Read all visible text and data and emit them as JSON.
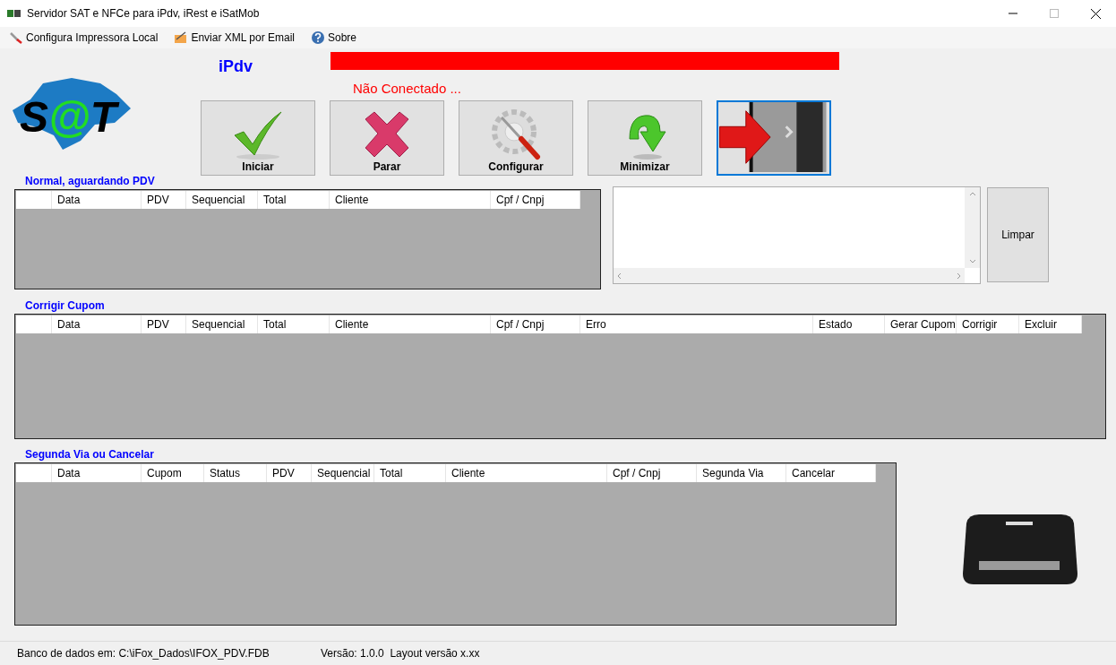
{
  "window": {
    "title": "Servidor SAT e NFCe para iPdv, iRest e iSatMob"
  },
  "menu": [
    {
      "label": "Configura Impressora Local",
      "kind": "printer"
    },
    {
      "label": "Enviar XML por Email",
      "kind": "mail"
    },
    {
      "label": "Sobre",
      "kind": "help"
    }
  ],
  "logo": {
    "parts": [
      "S",
      "@",
      "T"
    ]
  },
  "header": {
    "module": "iPdv",
    "connected": false,
    "status": "Não Conectado ..."
  },
  "buttons": [
    {
      "label": "Iniciar",
      "kind": "start",
      "focused": false
    },
    {
      "label": "Parar",
      "kind": "stop",
      "focused": false
    },
    {
      "label": "Configurar",
      "kind": "config",
      "focused": false
    },
    {
      "label": "Minimizar",
      "kind": "minimize",
      "focused": false
    },
    {
      "kind": "exit",
      "focused": true
    }
  ],
  "grids": [
    {
      "title": "Normal, aguardando PDV",
      "columns": [
        "Data",
        "PDV",
        "Sequencial",
        "Total",
        "Cliente",
        "Cpf / Cnpj"
      ]
    },
    {
      "title": "Corrigir Cupom",
      "columns": [
        "Data",
        "PDV",
        "Sequencial",
        "Total",
        "Cliente",
        "Cpf / Cnpj",
        "Erro",
        "Estado",
        "Gerar Cupom",
        "Corrigir",
        "Excluir"
      ]
    },
    {
      "title": "Segunda Via ou Cancelar",
      "columns": [
        "Data",
        "Cupom",
        "Status",
        "PDV",
        "Sequencial",
        "Total",
        "Cliente",
        "Cpf / Cnpj",
        "Segunda Via",
        "Cancelar"
      ]
    }
  ],
  "log": {
    "clear_button": "Limpar"
  },
  "status_bar": {
    "database": "Banco de dados em: C:\\iFox_Dados\\IFOX_PDV.FDB",
    "version": "Versão: 1.0.0  Layout versão x.xx"
  }
}
